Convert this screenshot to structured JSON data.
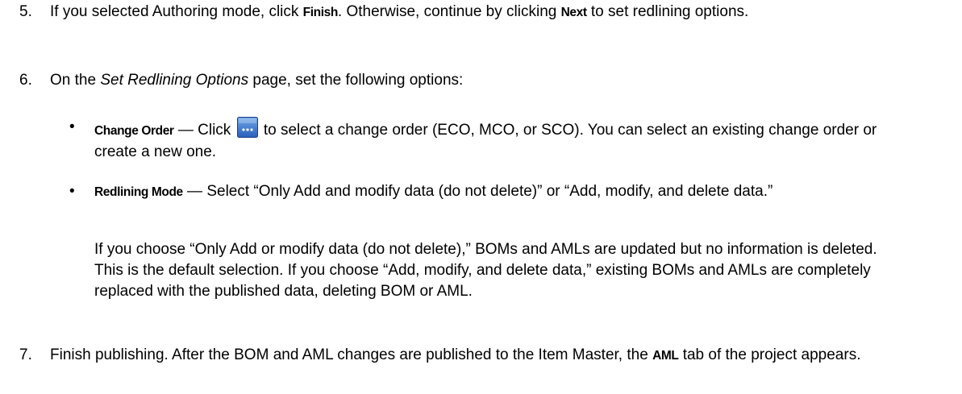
{
  "steps": {
    "s5": {
      "num": "5.",
      "t1": "If you selected Authoring mode, click ",
      "b1": "Finish",
      "t2": ". Otherwise, continue by clicking ",
      "b2": "Next",
      "t3": " to set redlining options."
    },
    "s6": {
      "num": "6.",
      "t1": "On the ",
      "i1": "Set Redlining Options",
      "t2": " page, set the following options:"
    },
    "s7": {
      "num": "7.",
      "t1": "Finish publishing. After the BOM and AML changes are published to the Item Master, the ",
      "b1": "AML",
      "t2": " tab of the project appears."
    }
  },
  "bullets": {
    "change_order": {
      "dot": "•",
      "label": "Change Order",
      "t1": " — Click ",
      "icon": "ellipsis-browse-button-icon",
      "t2": " to select a change order (ECO, MCO, or SCO). You can select an existing change order or create a new one."
    },
    "redlining_mode": {
      "dot": "•",
      "label": "Redlining Mode",
      "t1": " — Select “Only Add and modify data (do not delete)” or “Add, modify, and delete data.”"
    }
  },
  "redlining_para": "If you choose “Only Add or modify data (do not delete),” BOMs and AMLs are updated but no information is deleted. This is the default selection. If you choose “Add, modify, and delete data,” existing BOMs and AMLs are completely replaced with the published data, deleting BOM or AML.",
  "colors": {
    "text": "#000000",
    "icon_blue": "#2f6fc9",
    "icon_dark": "#1d3f8a"
  }
}
